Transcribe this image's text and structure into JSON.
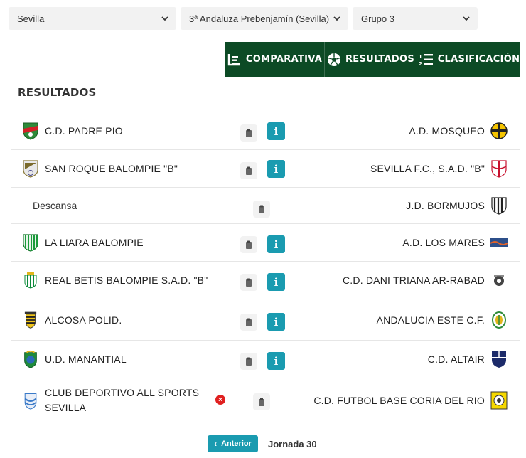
{
  "filters": [
    {
      "value": "Sevilla"
    },
    {
      "value": "3ª Andaluza Prebenjamín (Sevilla)"
    },
    {
      "value": "Grupo 3"
    }
  ],
  "tabs": [
    {
      "label": "COMPARATIVA",
      "icon": "chart-icon"
    },
    {
      "label": "RESULTADOS",
      "icon": "football-icon"
    },
    {
      "label": "CLASIFICACIÓN",
      "icon": "ranking-list-icon"
    }
  ],
  "section_title": "RESULTADOS",
  "matches": [
    {
      "home": "C.D. PADRE PIO",
      "away": "A.D. MOSQUEO",
      "info": "i"
    },
    {
      "home": "SAN ROQUE BALOMPIE \"B\"",
      "away": "SEVILLA F.C., S.A.D. \"B\"",
      "info": "i"
    },
    {
      "rest_label": "Descansa",
      "away": "J.D. BORMUJOS"
    },
    {
      "home": "LA LIARA BALOMPIE",
      "away": "A.D. LOS MARES",
      "info": "i"
    },
    {
      "home": "REAL BETIS BALOMPIE S.A.D. \"B\"",
      "away": "C.D. DANI TRIANA AR-RABAD",
      "info": "i"
    },
    {
      "home": "ALCOSA POLID.",
      "away": "ANDALUCIA ESTE C.F.",
      "info": "i"
    },
    {
      "home": "U.D. MANANTIAL",
      "away": "C.D. ALTAIR",
      "info": "i"
    },
    {
      "home_line1": "CLUB DEPORTIVO ALL SPORTS",
      "home_line2": "SEVILLA",
      "away": "C.D. FUTBOL BASE CORIA DEL RIO",
      "status_badge": "×"
    }
  ],
  "pager": {
    "prev_label": "Anterior",
    "jornada": "Jornada 30"
  },
  "colors": {
    "tab_bg": "#0c4a25",
    "info_bg": "#1a9bb0",
    "cancelled": "#e02020"
  }
}
